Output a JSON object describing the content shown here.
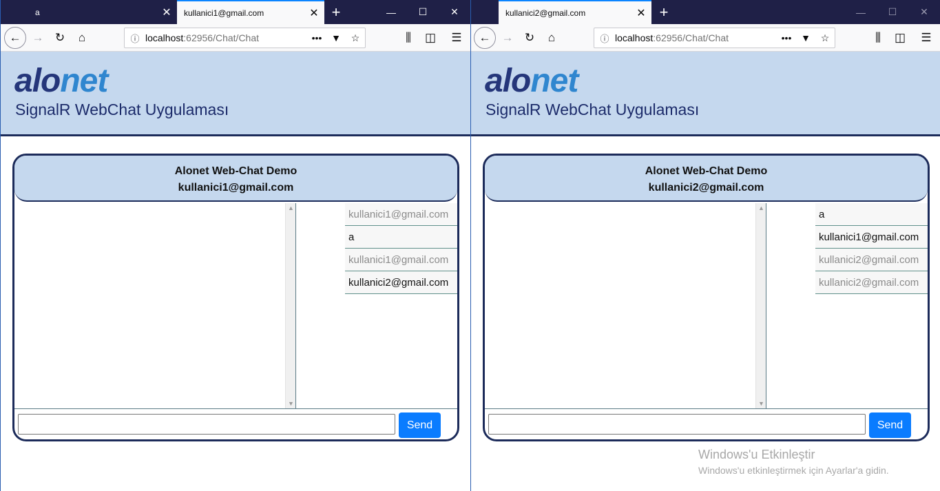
{
  "left": {
    "tabs": [
      {
        "label": "a",
        "active": false
      },
      {
        "label": "kullanici1@gmail.com",
        "active": true
      }
    ],
    "url": {
      "host": "localhost",
      "path": ":62956/Chat/Chat"
    },
    "logo": {
      "alo": "alo",
      "net": "net"
    },
    "subtitle": "SignalR WebChat Uygulaması",
    "chat": {
      "title": "Alonet Web-Chat Demo",
      "user": "kullanici1@gmail.com",
      "users": [
        {
          "label": "kullanici1@gmail.com",
          "style": "muted"
        },
        {
          "label": "a",
          "style": "strong"
        },
        {
          "label": "kullanici1@gmail.com",
          "style": "muted"
        },
        {
          "label": "kullanici2@gmail.com",
          "style": "strong"
        }
      ],
      "input_value": "",
      "send_label": "Send"
    }
  },
  "right": {
    "tabs": [
      {
        "label": "kullanici2@gmail.com",
        "active": true
      }
    ],
    "url": {
      "host": "localhost",
      "path": ":62956/Chat/Chat"
    },
    "logo": {
      "alo": "alo",
      "net": "net"
    },
    "subtitle": "SignalR WebChat Uygulaması",
    "chat": {
      "title": "Alonet Web-Chat Demo",
      "user": "kullanici2@gmail.com",
      "users": [
        {
          "label": "a",
          "style": "strong"
        },
        {
          "label": "kullanici1@gmail.com",
          "style": "strong"
        },
        {
          "label": "kullanici2@gmail.com",
          "style": "muted"
        },
        {
          "label": "kullanici2@gmail.com",
          "style": "muted"
        }
      ],
      "input_value": "",
      "send_label": "Send"
    },
    "watermark": {
      "title": "Windows'u Etkinleştir",
      "text": "Windows'u etkinleştirmek için Ayarlar'a gidin."
    }
  },
  "icons": {
    "back": "back-arrow-icon",
    "forward": "forward-arrow-icon",
    "reload": "reload-icon",
    "home": "home-icon",
    "info": "info-icon",
    "more": "more-dots-icon",
    "pocket": "pocket-icon",
    "bookmark": "star-icon",
    "library": "library-icon",
    "sidebar": "sidebar-icon",
    "menu": "hamburger-menu-icon"
  },
  "colors": {
    "accent": "#0a7cff",
    "header_bg": "#c5d8ee",
    "dark": "#1c2b5a",
    "tabstrip": "#1f2047"
  }
}
